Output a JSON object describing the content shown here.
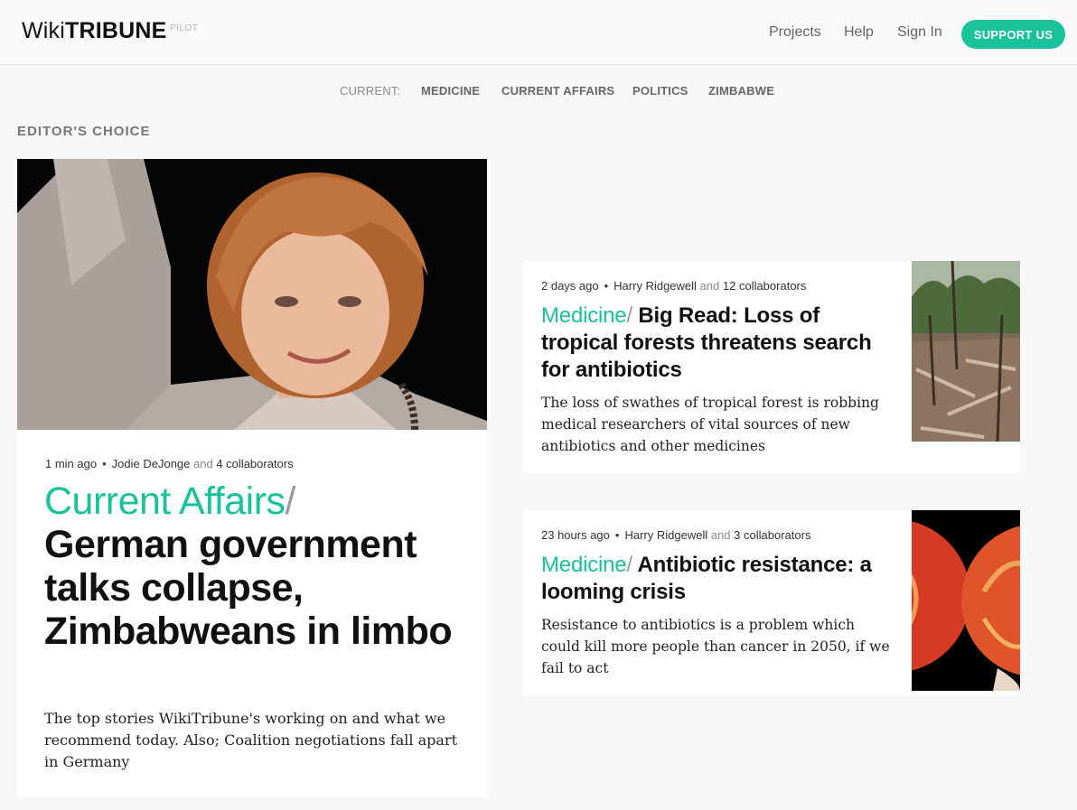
{
  "header": {
    "logo_wiki": "Wiki",
    "logo_tribune": "TRIBUNE",
    "logo_pilot": "PILOT",
    "nav": [
      "Projects",
      "Help",
      "Sign In"
    ],
    "support_label": "SUPPORT US"
  },
  "topics": {
    "label": "CURRENT:",
    "items": [
      "MEDICINE",
      "CURRENT AFFAIRS",
      "POLITICS",
      "ZIMBABWE"
    ]
  },
  "section_title": "EDITOR'S CHOICE",
  "feature": {
    "time": "1 min ago",
    "author": "Jodie DeJonge",
    "and": "and",
    "collaborators": "4 collaborators",
    "category": "Current Affairs",
    "slash": "/",
    "title": "German government talks collapse, Zimbabweans in limbo",
    "summary": "The top stories WikiTribune's working on and what we recommend today. Also; Coalition negotiations fall apart in Germany"
  },
  "cards": [
    {
      "time": "2 days ago",
      "author": "Harry Ridgewell",
      "and": "and",
      "collaborators": "12 collaborators",
      "category": "Medicine",
      "slash": "/",
      "title": "Big Read: Loss of tropical forests threatens search for antibiotics",
      "summary": "The loss of swathes of tropical forest is robbing medical researchers of vital sources of new antibiotics and other medicines"
    },
    {
      "time": "23 hours ago",
      "author": "Harry Ridgewell",
      "and": "and",
      "collaborators": "3 collaborators",
      "category": "Medicine",
      "slash": "/",
      "title": "Antibiotic resistance: a looming crisis",
      "summary": "Resistance to antibiotics is a problem which could kill more people than cancer in 2050, if we fail to act"
    }
  ],
  "colors": {
    "accent": "#19c29b",
    "background": "#f7f7f7"
  }
}
